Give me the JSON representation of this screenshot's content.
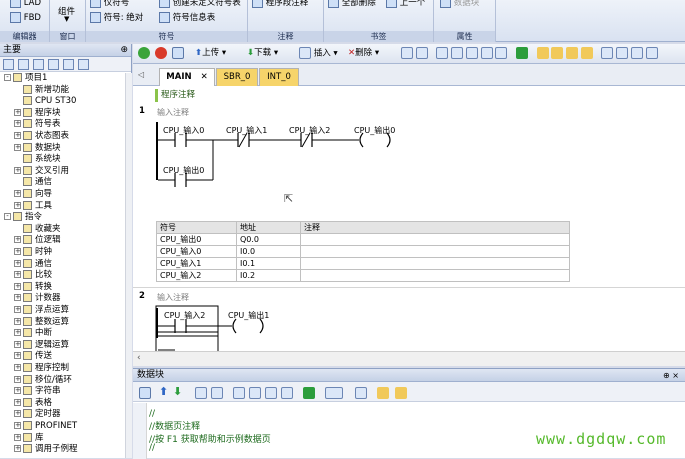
{
  "ribbon": {
    "groups": [
      {
        "label": "编辑器",
        "items": [
          "LAD",
          "FBD"
        ]
      },
      {
        "label": "窗口",
        "items": [
          "组件"
        ]
      },
      {
        "label": "符号",
        "items": [
          "仅符号",
          "符号: 绝对",
          "创建未定义符号表",
          "符号信息表"
        ]
      },
      {
        "label": "注释",
        "items": [
          "程序段注释"
        ]
      },
      {
        "label": "书签",
        "items": [
          "全部删除",
          "上一个"
        ]
      },
      {
        "label": "属性",
        "items": [
          "数据块"
        ]
      }
    ]
  },
  "left_panel": {
    "title": "主要",
    "pin": "⊕",
    "tree": [
      {
        "exp": "-",
        "label": "项目1",
        "indent": 0
      },
      {
        "exp": "",
        "label": "新增功能",
        "indent": 1
      },
      {
        "exp": "",
        "label": "CPU ST30",
        "indent": 1
      },
      {
        "exp": "+",
        "label": "程序块",
        "indent": 1
      },
      {
        "exp": "+",
        "label": "符号表",
        "indent": 1
      },
      {
        "exp": "+",
        "label": "状态图表",
        "indent": 1
      },
      {
        "exp": "+",
        "label": "数据块",
        "indent": 1
      },
      {
        "exp": "",
        "label": "系统块",
        "indent": 1
      },
      {
        "exp": "+",
        "label": "交叉引用",
        "indent": 1
      },
      {
        "exp": "",
        "label": "通信",
        "indent": 1
      },
      {
        "exp": "+",
        "label": "向导",
        "indent": 1
      },
      {
        "exp": "+",
        "label": "工具",
        "indent": 1
      },
      {
        "exp": "-",
        "label": "指令",
        "indent": 0
      },
      {
        "exp": "",
        "label": "收藏夹",
        "indent": 1
      },
      {
        "exp": "+",
        "label": "位逻辑",
        "indent": 1
      },
      {
        "exp": "+",
        "label": "时钟",
        "indent": 1
      },
      {
        "exp": "+",
        "label": "通信",
        "indent": 1
      },
      {
        "exp": "+",
        "label": "比较",
        "indent": 1
      },
      {
        "exp": "+",
        "label": "转换",
        "indent": 1
      },
      {
        "exp": "+",
        "label": "计数器",
        "indent": 1
      },
      {
        "exp": "+",
        "label": "浮点运算",
        "indent": 1
      },
      {
        "exp": "+",
        "label": "整数运算",
        "indent": 1
      },
      {
        "exp": "+",
        "label": "中断",
        "indent": 1
      },
      {
        "exp": "+",
        "label": "逻辑运算",
        "indent": 1
      },
      {
        "exp": "+",
        "label": "传送",
        "indent": 1
      },
      {
        "exp": "+",
        "label": "程序控制",
        "indent": 1
      },
      {
        "exp": "+",
        "label": "移位/循环",
        "indent": 1
      },
      {
        "exp": "+",
        "label": "字符串",
        "indent": 1
      },
      {
        "exp": "+",
        "label": "表格",
        "indent": 1
      },
      {
        "exp": "+",
        "label": "定时器",
        "indent": 1
      },
      {
        "exp": "+",
        "label": "PROFINET",
        "indent": 1
      },
      {
        "exp": "+",
        "label": "库",
        "indent": 1
      },
      {
        "exp": "+",
        "label": "调用子例程",
        "indent": 1
      }
    ]
  },
  "editor": {
    "toolbar": {
      "upload": "上传",
      "download": "下载",
      "insert": "插入",
      "delete": "删除"
    },
    "tabs": [
      "MAIN",
      "SBR_0",
      "INT_0"
    ],
    "active_tab": "MAIN",
    "program_comment": "程序注释",
    "networks": [
      {
        "num": "1",
        "comment": "输入注释",
        "contacts": [
          "CPU_输入0",
          "CPU_输入1",
          "CPU_输入2"
        ],
        "contact_types": [
          "",
          "/",
          "/"
        ],
        "coil": "CPU_输出0",
        "branch_contact": "CPU_输出0",
        "symbol_table": {
          "headers": [
            "符号",
            "地址",
            "注释"
          ],
          "rows": [
            [
              "CPU_输出0",
              "Q0.0",
              ""
            ],
            [
              "CPU_输入0",
              "I0.0",
              ""
            ],
            [
              "CPU_输入1",
              "I0.1",
              ""
            ],
            [
              "CPU_输入2",
              "I0.2",
              ""
            ]
          ]
        }
      },
      {
        "num": "2",
        "comment": "输入注释",
        "contact": "CPU_输入2",
        "coil": "CPU_输出1"
      }
    ]
  },
  "datablock": {
    "title": "数据块",
    "pin": "⊕ ×",
    "lines": [
      "//",
      "//数据页注释",
      "//按 F1 获取帮助和示例数据页",
      "//"
    ]
  },
  "watermark": "www.dgdqw.com"
}
